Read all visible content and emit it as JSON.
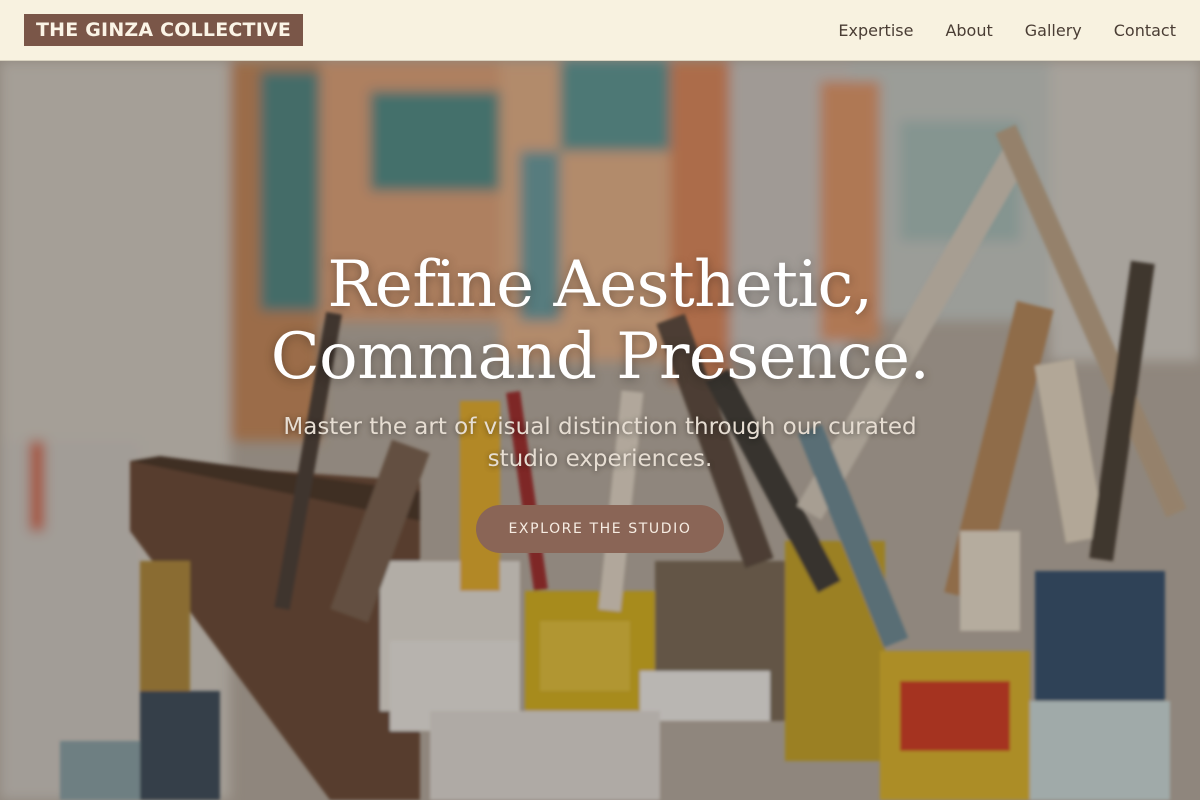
{
  "brand": {
    "name": "THE GINZA COLLECTIVE"
  },
  "nav": {
    "items": [
      {
        "label": "Expertise"
      },
      {
        "label": "About"
      },
      {
        "label": "Gallery"
      },
      {
        "label": "Contact"
      }
    ]
  },
  "hero": {
    "title_line1": "Refine Aesthetic,",
    "title_line2": "Command Presence.",
    "subtitle": "Master the art of visual distinction through our curated studio experiences.",
    "cta_label": "EXPLORE THE STUDIO",
    "background": "artist-studio-paint-cans-brushes-photo"
  },
  "colors": {
    "header_bg": "#f8f2e0",
    "logo_bg": "#7a5648",
    "cta_bg": "#8a6556"
  }
}
